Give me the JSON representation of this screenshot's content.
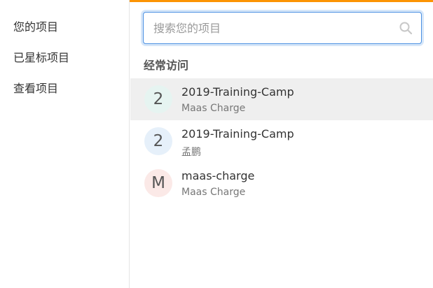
{
  "colors": {
    "accent": "#fc9403",
    "focus_border": "#4a90e2",
    "active_row": "#efefef"
  },
  "sidebar": {
    "items": [
      {
        "label": "您的项目"
      },
      {
        "label": "已星标项目"
      },
      {
        "label": "查看项目"
      }
    ]
  },
  "search": {
    "placeholder": "搜索您的项目",
    "value": "",
    "icon": "search-icon"
  },
  "frequent": {
    "title": "经常访问",
    "items": [
      {
        "avatar": "2",
        "avatar_color": "#e6f4f1",
        "title": "2019-Training-Camp",
        "subtitle": "Maas Charge",
        "active": true
      },
      {
        "avatar": "2",
        "avatar_color": "#e6f0fa",
        "title": "2019-Training-Camp",
        "subtitle": "孟鹏",
        "active": false
      },
      {
        "avatar": "M",
        "avatar_color": "#fbe9e7",
        "title": "maas-charge",
        "subtitle": "Maas Charge",
        "active": false
      }
    ]
  }
}
